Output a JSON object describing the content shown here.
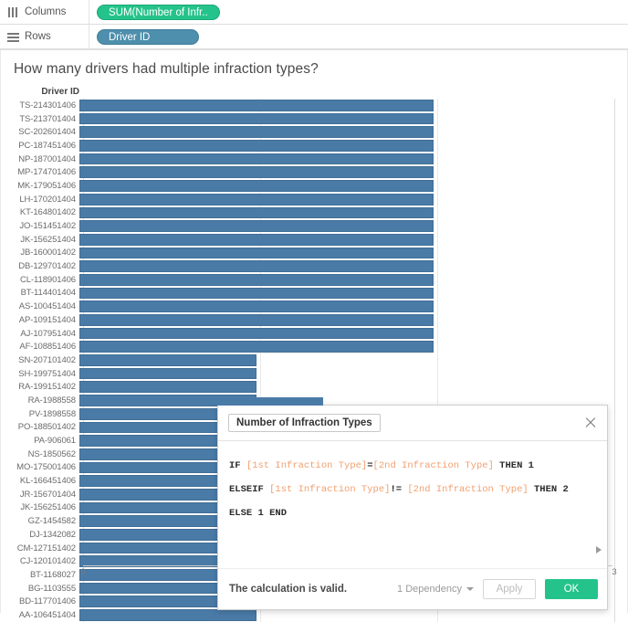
{
  "shelves": {
    "columns": {
      "label": "Columns",
      "icon": "columns-icon",
      "pill": "SUM(Number of Infr.."
    },
    "rows": {
      "label": "Rows",
      "icon": "rows-icon",
      "pill": "Driver ID"
    }
  },
  "worksheet": {
    "title": "How many drivers had multiple infraction types?",
    "row_header": "Driver ID"
  },
  "chart_data": {
    "type": "bar",
    "orientation": "horizontal",
    "title": "How many drivers had multiple infraction types?",
    "xlabel": "Number of Infraction Types",
    "ylabel": "Driver ID",
    "xlim": [
      0,
      3
    ],
    "xticks": [
      "0",
      "1",
      "2",
      "3"
    ],
    "grid": true,
    "bar_color": "#4a7ba7",
    "categories": [
      "TS-214301406",
      "TS-213701404",
      "SC-202601404",
      "PC-187451406",
      "NP-187001404",
      "MP-174701406",
      "MK-179051406",
      "LH-170201404",
      "KT-164801402",
      "JO-151451402",
      "JK-156251404",
      "JB-160001402",
      "DB-129701402",
      "CL-118901406",
      "BT-114401404",
      "AS-100451404",
      "AP-109151404",
      "AJ-107951404",
      "AF-108851406",
      "SN-207101402",
      "SH-199751404",
      "RA-199151402",
      "RA-1988558",
      "PV-1898558",
      "PO-188501402",
      "PA-906061",
      "NS-1850562",
      "MO-175001406",
      "KL-166451406",
      "JR-156701404",
      "JK-156251406",
      "GZ-1454582",
      "DJ-1342082",
      "CM-127151402",
      "CJ-120101402",
      "BT-1168027",
      "BG-1103555",
      "BD-117701406",
      "AA-106451404"
    ],
    "values": [
      2,
      2,
      2,
      2,
      2,
      2,
      2,
      2,
      2,
      2,
      2,
      2,
      2,
      2,
      2,
      2,
      2,
      2,
      2,
      1,
      1,
      1,
      1,
      1,
      1,
      1,
      1,
      1,
      1,
      1,
      1,
      1,
      1,
      1,
      1,
      1,
      1,
      1,
      1
    ]
  },
  "calc_dialog": {
    "name_value": "Number of Infraction Types",
    "close_icon": "close-icon",
    "formula_lines": [
      {
        "segments": [
          {
            "text": "IF ",
            "kind": "kw"
          },
          {
            "text": "[1st Infraction Type]",
            "kind": "fld"
          },
          {
            "text": "=",
            "kind": "kw"
          },
          {
            "text": "[2nd Infraction Type]",
            "kind": "fld"
          },
          {
            "text": " THEN 1",
            "kind": "kw"
          }
        ]
      },
      {
        "segments": [
          {
            "text": "ELSEIF ",
            "kind": "kw"
          },
          {
            "text": "[1st Infraction Type]",
            "kind": "fld"
          },
          {
            "text": "!= ",
            "kind": "kw"
          },
          {
            "text": "[2nd Infraction Type]",
            "kind": "fld"
          },
          {
            "text": " THEN 2",
            "kind": "kw"
          }
        ]
      },
      {
        "segments": [
          {
            "text": "ELSE 1 END",
            "kind": "kw"
          }
        ]
      }
    ],
    "status": "The calculation is valid.",
    "dependency": "1 Dependency",
    "apply_label": "Apply",
    "ok_label": "OK"
  }
}
